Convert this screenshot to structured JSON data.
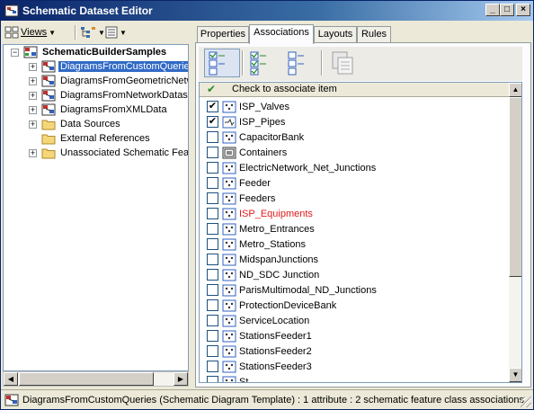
{
  "window": {
    "title": "Schematic Dataset Editor",
    "minimize_label": "_",
    "maximize_label": "□",
    "close_label": "×"
  },
  "toolbar": {
    "views_label": "Views",
    "views_icon": "views-icon",
    "layout_icon": "tree-layout-icon",
    "list_icon": "list-options-icon"
  },
  "tree": {
    "root": {
      "label": "SchematicBuilderSamples",
      "icon": "schematic-dataset-icon"
    },
    "items": [
      {
        "label": "DiagramsFromCustomQueries",
        "icon": "diagram-template-icon",
        "selected": true,
        "has_children": true
      },
      {
        "label": "DiagramsFromGeometricNetwork",
        "icon": "diagram-template-icon",
        "selected": false,
        "has_children": true
      },
      {
        "label": "DiagramsFromNetworkDataset",
        "icon": "diagram-template-icon",
        "selected": false,
        "has_children": true
      },
      {
        "label": "DiagramsFromXMLData",
        "icon": "diagram-template-icon",
        "selected": false,
        "has_children": true
      },
      {
        "label": "Data Sources",
        "icon": "folder-icon",
        "selected": false,
        "has_children": true
      },
      {
        "label": "External References",
        "icon": "folder-icon",
        "selected": false,
        "has_children": false
      },
      {
        "label": "Unassociated Schematic Feature Classes",
        "icon": "folder-icon",
        "selected": false,
        "has_children": true
      }
    ]
  },
  "tabs": [
    {
      "label": "Properties",
      "active": false
    },
    {
      "label": "Associations",
      "active": true
    },
    {
      "label": "Layouts",
      "active": false
    },
    {
      "label": "Rules",
      "active": false
    }
  ],
  "assoc_toolbar": {
    "buttons": [
      {
        "name": "show-all-button",
        "icon": "show-all-icon",
        "pressed": true
      },
      {
        "name": "show-checked-button",
        "icon": "show-checked-icon",
        "pressed": false
      },
      {
        "name": "show-unchecked-button",
        "icon": "show-unchecked-icon",
        "pressed": false
      },
      {
        "name": "copy-associations-button",
        "icon": "copy-icon",
        "pressed": false
      }
    ]
  },
  "list": {
    "header": "Check to associate item",
    "rows": [
      {
        "label": "ISP_Valves",
        "checked": true,
        "icon": "node-class-icon",
        "red": false
      },
      {
        "label": "ISP_Pipes",
        "checked": true,
        "icon": "link-class-icon",
        "red": false
      },
      {
        "label": "CapacitorBank",
        "checked": false,
        "icon": "node-class-icon",
        "red": false
      },
      {
        "label": "Containers",
        "checked": false,
        "icon": "container-class-icon",
        "red": false
      },
      {
        "label": "ElectricNetwork_Net_Junctions",
        "checked": false,
        "icon": "node-class-icon",
        "red": false
      },
      {
        "label": "Feeder",
        "checked": false,
        "icon": "node-class-icon",
        "red": false
      },
      {
        "label": "Feeders",
        "checked": false,
        "icon": "node-class-icon",
        "red": false
      },
      {
        "label": "ISP_Equipments",
        "checked": false,
        "icon": "node-class-icon",
        "red": true
      },
      {
        "label": "Metro_Entrances",
        "checked": false,
        "icon": "node-class-icon",
        "red": false
      },
      {
        "label": "Metro_Stations",
        "checked": false,
        "icon": "node-class-icon",
        "red": false
      },
      {
        "label": "MidspanJunctions",
        "checked": false,
        "icon": "node-class-icon",
        "red": false
      },
      {
        "label": "ND_SDC Junction",
        "checked": false,
        "icon": "node-class-icon",
        "red": false
      },
      {
        "label": "ParisMultimodal_ND_Junctions",
        "checked": false,
        "icon": "node-class-icon",
        "red": false
      },
      {
        "label": "ProtectionDeviceBank",
        "checked": false,
        "icon": "node-class-icon",
        "red": false
      },
      {
        "label": "ServiceLocation",
        "checked": false,
        "icon": "node-class-icon",
        "red": false
      },
      {
        "label": "StationsFeeder1",
        "checked": false,
        "icon": "node-class-icon",
        "red": false
      },
      {
        "label": "StationsFeeder2",
        "checked": false,
        "icon": "node-class-icon",
        "red": false
      },
      {
        "label": "StationsFeeder3",
        "checked": false,
        "icon": "node-class-icon",
        "red": false
      },
      {
        "label": "St...",
        "checked": false,
        "icon": "node-class-icon",
        "red": false
      }
    ]
  },
  "status": {
    "text": "DiagramsFromCustomQueries (Schematic Diagram Template) : 1 attribute : 2 schematic feature class associations",
    "icon": "diagram-template-icon"
  },
  "colors": {
    "selection": "#316ac5",
    "title_bar": "#0a246a",
    "warning_text": "#e21a1a"
  }
}
